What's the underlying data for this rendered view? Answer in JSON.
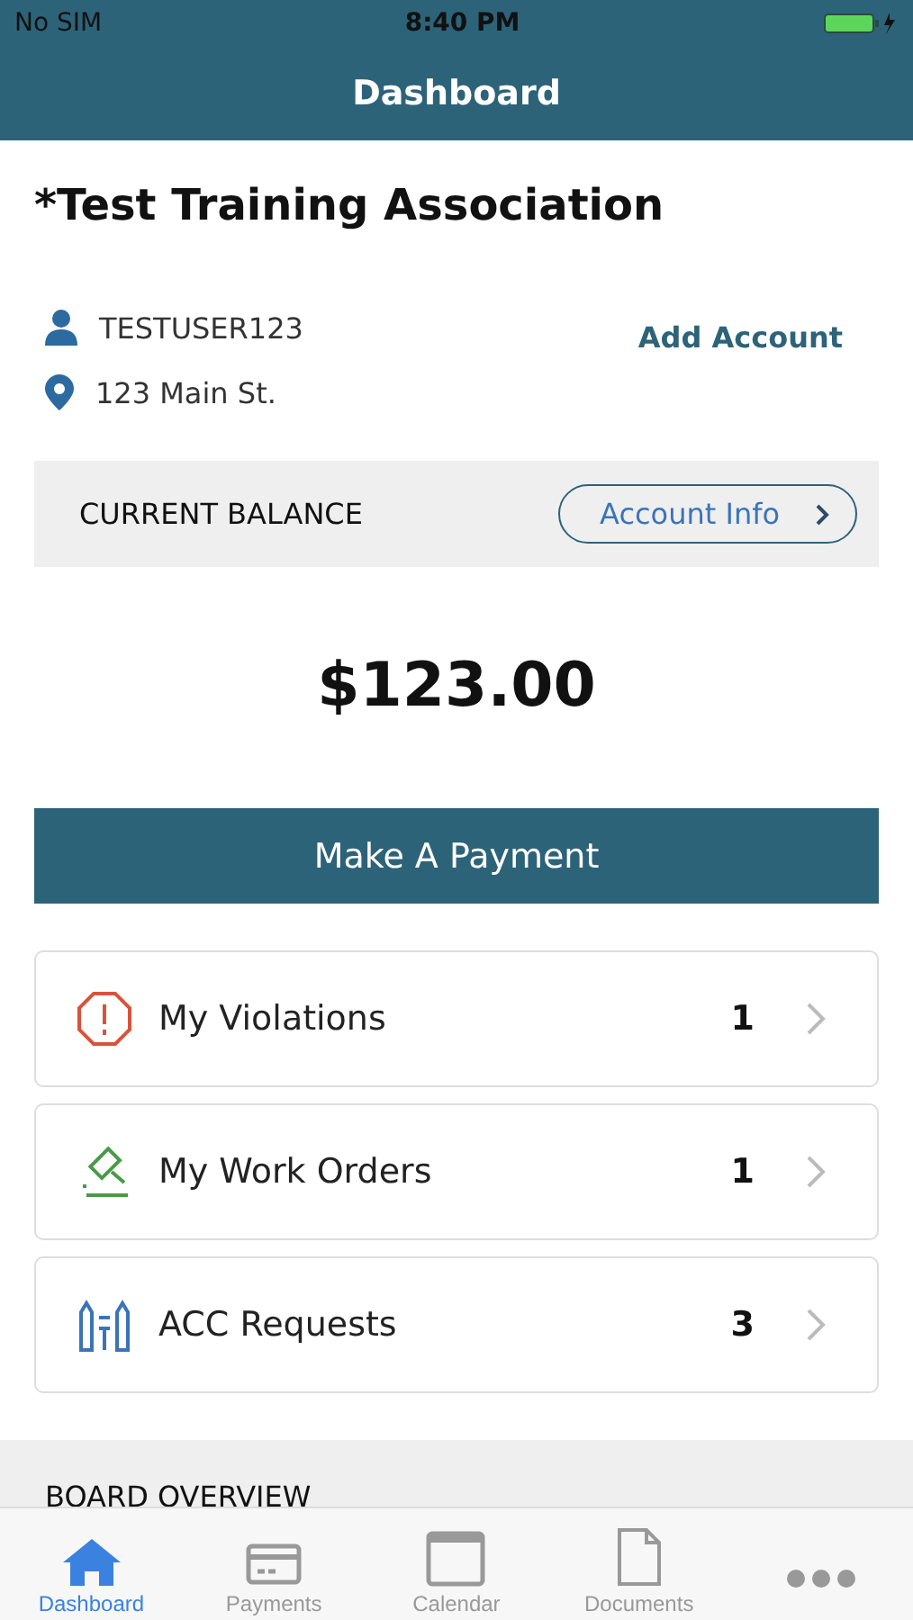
{
  "status_bar": {
    "carrier": "No SIM",
    "time": "8:40 PM"
  },
  "nav": {
    "title": "Dashboard"
  },
  "association": "*Test Training Association",
  "account": {
    "username": "TESTUSER123",
    "address": "123 Main St.",
    "add_link": "Add Account"
  },
  "balance": {
    "label": "CURRENT BALANCE",
    "info_button": "Account Info",
    "amount": "$123.00"
  },
  "payment_button": "Make A Payment",
  "cards": [
    {
      "kind": "violations",
      "label": "My Violations",
      "count": "1"
    },
    {
      "kind": "work_orders",
      "label": "My Work Orders",
      "count": "1"
    },
    {
      "kind": "acc",
      "label": "ACC Requests",
      "count": "3"
    }
  ],
  "section_heading": "BOARD OVERVIEW",
  "tabs": [
    {
      "kind": "home",
      "label": "Dashboard",
      "selected": true
    },
    {
      "kind": "card",
      "label": "Payments",
      "selected": false
    },
    {
      "kind": "calendar",
      "label": "Calendar",
      "selected": false
    },
    {
      "kind": "document",
      "label": "Documents",
      "selected": false
    },
    {
      "kind": "more",
      "selected": false
    }
  ]
}
